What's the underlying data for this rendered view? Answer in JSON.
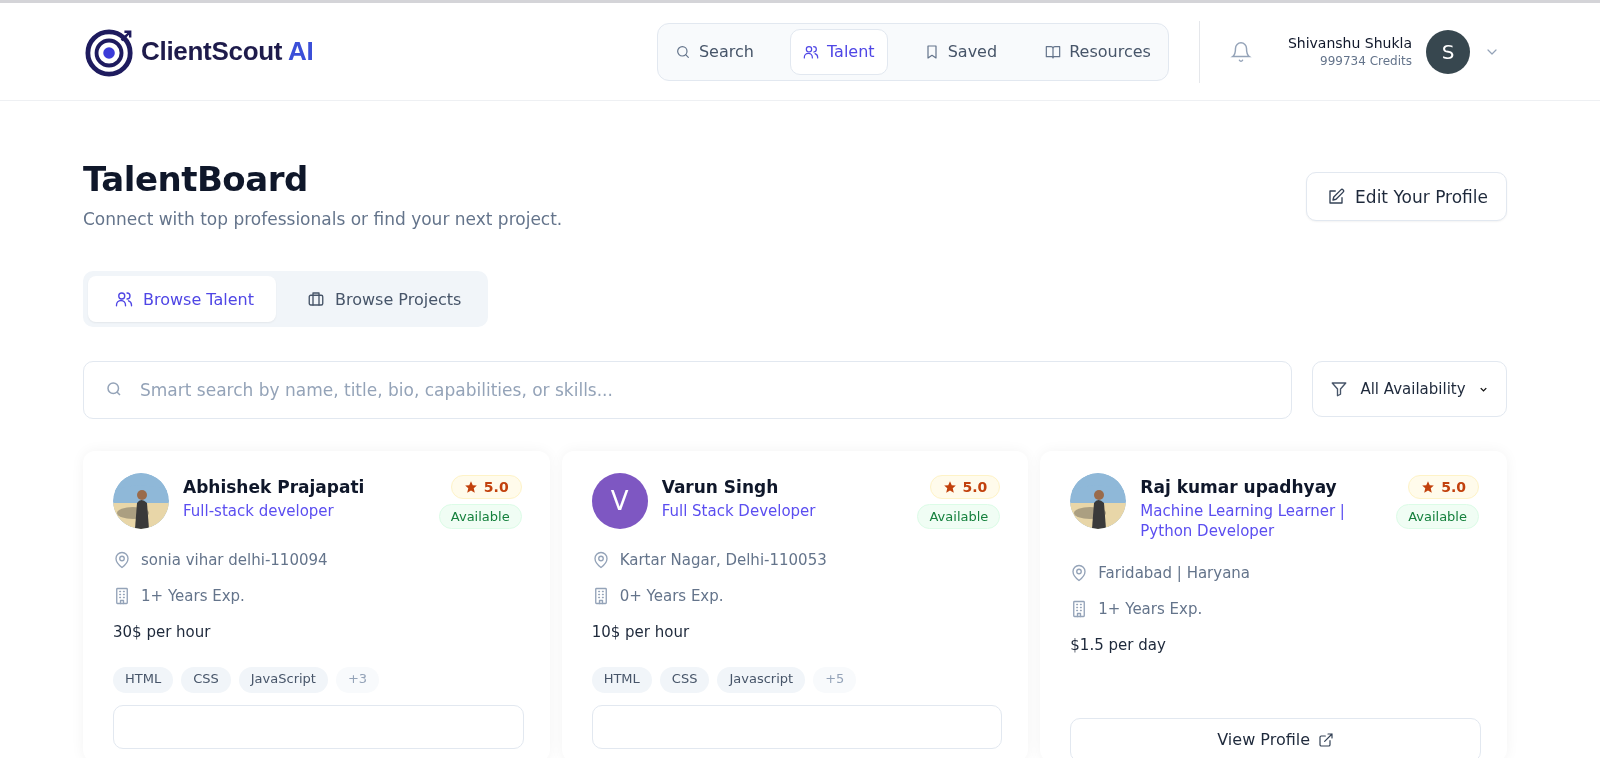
{
  "brand": {
    "name": "ClientScout",
    "suffix": "AI"
  },
  "nav": [
    {
      "label": "Search",
      "kind": "search",
      "selected": false
    },
    {
      "label": "Talent",
      "kind": "users",
      "selected": true
    },
    {
      "label": "Saved",
      "kind": "bookmark",
      "selected": false
    },
    {
      "label": "Resources",
      "kind": "book",
      "selected": false
    }
  ],
  "user": {
    "name": "Shivanshu Shukla",
    "credits": "999734 Credits",
    "initial": "S"
  },
  "page": {
    "title": "TalentBoard",
    "subtitle": "Connect with top professionals or find your next project.",
    "edit_button": "Edit Your Profile"
  },
  "tabs": [
    {
      "label": "Browse Talent",
      "kind": "users",
      "selected": true
    },
    {
      "label": "Browse Projects",
      "kind": "briefcase",
      "selected": false
    }
  ],
  "search": {
    "placeholder": "Smart search by name, title, bio, capabilities, or skills..."
  },
  "filter": {
    "label": "All Availability"
  },
  "cards": [
    {
      "avatar": {
        "kind": "picture"
      },
      "name": "Abhishek Prajapati",
      "title": "Full-stack developer",
      "rating": "5.0",
      "status": "Available",
      "location": "sonia vihar delhi-110094",
      "experience": "1+ Years Exp.",
      "rate": "30$ per hour",
      "skills": [
        "HTML",
        "CSS",
        "JavaScript"
      ],
      "more": "+3"
    },
    {
      "avatar": {
        "kind": "initial",
        "initial": "V",
        "color": "#7e57c2"
      },
      "name": "Varun Singh",
      "title": "Full Stack Developer",
      "rating": "5.0",
      "status": "Available",
      "location": "Kartar Nagar, Delhi-110053",
      "experience": "0+ Years Exp.",
      "rate": "10$ per hour",
      "skills": [
        "HTML",
        "CSS",
        "Javascript"
      ],
      "more": "+5"
    },
    {
      "avatar": {
        "kind": "picture"
      },
      "name": "Raj kumar upadhyay",
      "title": "Machine Learning Learner | Python Developer",
      "rating": "5.0",
      "status": "Available",
      "location": "Faridabad | Haryana",
      "experience": "1+ Years Exp.",
      "rate": "$1.5 per day",
      "view_button": "View Profile"
    }
  ]
}
